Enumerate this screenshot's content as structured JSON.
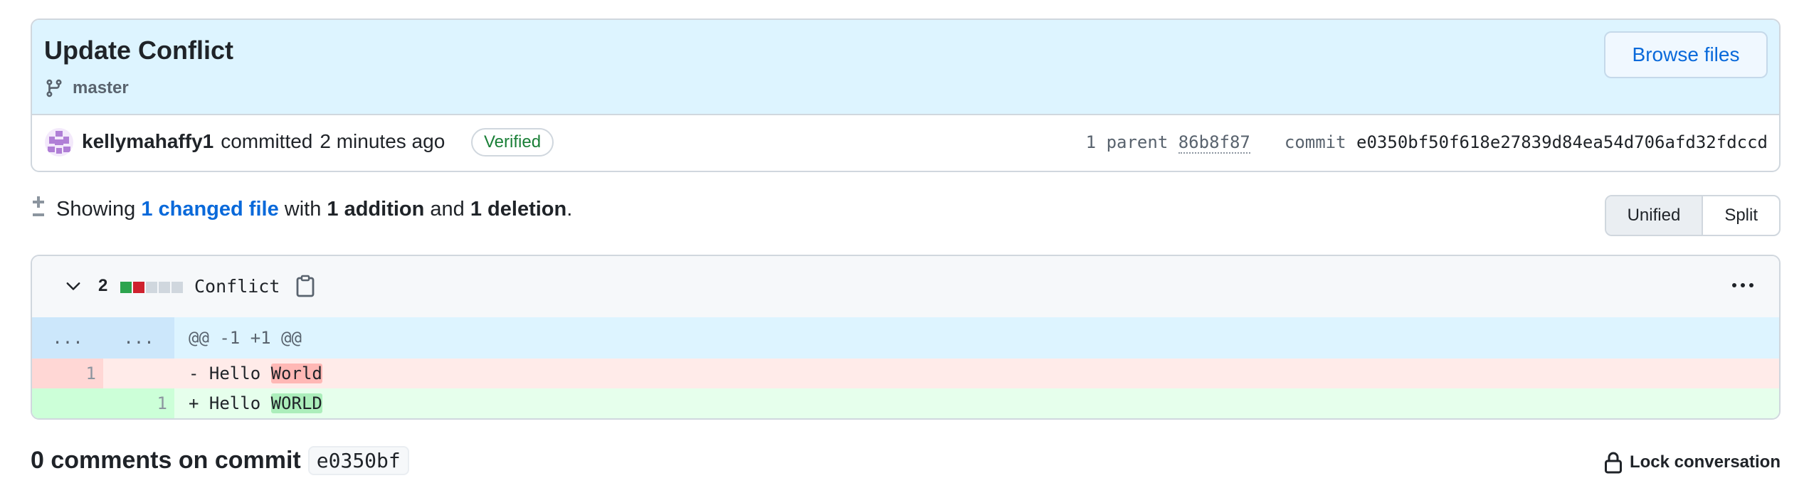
{
  "commit": {
    "title": "Update Conflict",
    "branch": "master",
    "browse_label": "Browse files",
    "author": "kellymahaffy1",
    "action": "committed",
    "time": "2 minutes ago",
    "verified_label": "Verified",
    "parent_label": "1 parent",
    "parent_sha": "86b8f87",
    "commit_label": "commit",
    "commit_sha": "e0350bf50f618e27839d84ea54d706afd32fdccd"
  },
  "summary": {
    "prefix": "Showing",
    "changed_files": "1 changed file",
    "with": "with",
    "additions": "1 addition",
    "and": "and",
    "deletions": "1 deletion",
    "period": "."
  },
  "view_toggle": {
    "unified": "Unified",
    "split": "Split",
    "selected": "Unified"
  },
  "file": {
    "change_count": "2",
    "name": "Conflict",
    "diffstat_colors": [
      "#2da44e",
      "#cf222e",
      "#d0d7de",
      "#d0d7de",
      "#d0d7de"
    ],
    "hunk": {
      "old_ln": "...",
      "new_ln": "...",
      "header": "@@ -1 +1 @@"
    },
    "lines": [
      {
        "type": "del",
        "old_ln": "1",
        "new_ln": "",
        "sign": "-",
        "text": " Hello ",
        "highlight": "World"
      },
      {
        "type": "add",
        "old_ln": "",
        "new_ln": "1",
        "sign": "+",
        "text": " Hello ",
        "highlight": "WORLD"
      }
    ]
  },
  "comments": {
    "count_text": "0 comments on commit",
    "sha": "e0350bf",
    "lock_label": "Lock conversation"
  },
  "colors": {
    "accent": "#0969da",
    "verified": "#1a7f37",
    "header_bg": "#ddf4ff"
  }
}
